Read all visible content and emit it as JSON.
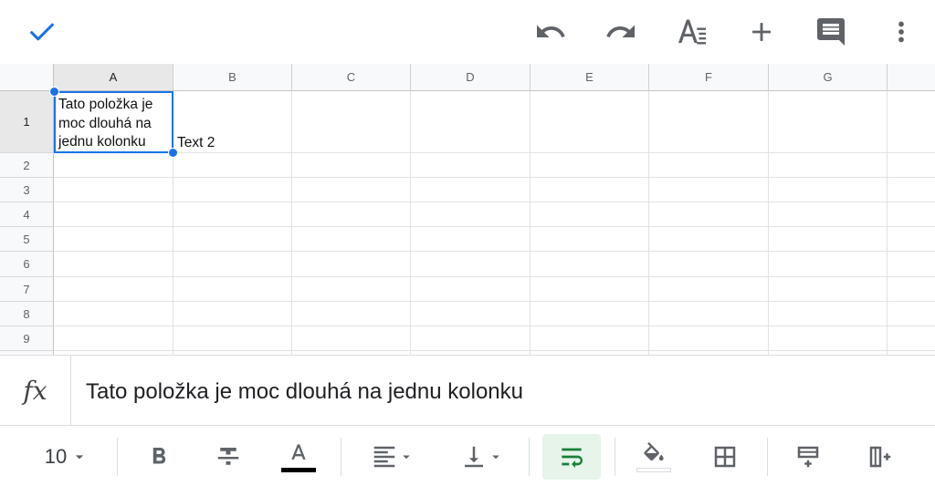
{
  "appbar": {
    "icons": [
      "check-icon",
      "undo-icon",
      "redo-icon",
      "text-format-icon",
      "add-icon",
      "comment-icon",
      "more-vert-icon"
    ]
  },
  "grid": {
    "columns": [
      "A",
      "B",
      "C",
      "D",
      "E",
      "F",
      "G"
    ],
    "rows": [
      "1",
      "2",
      "3",
      "4",
      "5",
      "6",
      "7",
      "8",
      "9"
    ],
    "selected_cell": "A1",
    "cells": {
      "a1_line1": "Tato položka je",
      "a1_line2": "moc dlouhá na",
      "a1_line3": "jednu kolonku",
      "b1": "Text 2"
    }
  },
  "formula_bar": {
    "fx_label": "fx",
    "value": "Tato položka je moc dlouhá na jednu kolonku"
  },
  "toolbar": {
    "font_size": "10",
    "text_color": "#000000",
    "wrap_active_bg": "#e6f4ea",
    "accent": "#1a73e8",
    "wrap_color": "#188038"
  }
}
